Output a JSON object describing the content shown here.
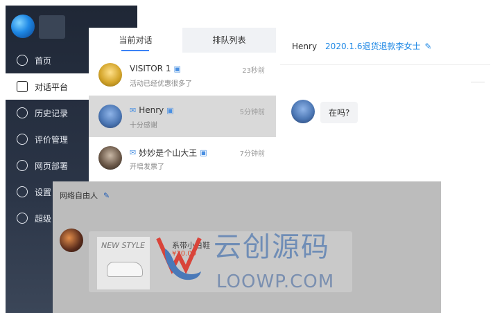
{
  "sidebar": {
    "items": [
      {
        "label": "首页",
        "icon": "home-icon"
      },
      {
        "label": "对话平台",
        "icon": "chat-icon"
      },
      {
        "label": "历史记录",
        "icon": "history-icon"
      },
      {
        "label": "评价管理",
        "icon": "rating-icon"
      },
      {
        "label": "网页部署",
        "icon": "deploy-icon"
      },
      {
        "label": "设置",
        "icon": "settings-icon"
      },
      {
        "label": "超级",
        "icon": "super-icon"
      }
    ]
  },
  "conversations": {
    "tabs": [
      "当前对话",
      "排队列表"
    ],
    "items": [
      {
        "name": "VISITOR 1",
        "preview": "活动已经优惠很多了",
        "time": "23秒前"
      },
      {
        "name": "Henry",
        "preview": "十分感谢",
        "time": "5分钟前"
      },
      {
        "name": "妙妙是个山大王",
        "preview": "开增发票了",
        "time": "7分钟前"
      }
    ]
  },
  "chat": {
    "user": "Henry",
    "title": "2020.1.6退货退款李女士",
    "message": "在吗?"
  },
  "overlay": {
    "header": "网络自由人",
    "product": {
      "style_text": "NEW STYLE",
      "title": "系带小白鞋",
      "price": "¥20.00"
    },
    "watermark_cn": "云创源码",
    "watermark_en": "LOOWP.COM"
  }
}
